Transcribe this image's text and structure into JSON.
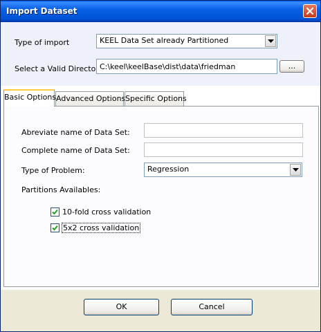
{
  "window": {
    "title": "Import Dataset"
  },
  "import": {
    "type_label": "Type of import",
    "type_value": "KEEL Data Set already Partitioned",
    "dir_label": "Select a Valid Directory",
    "dir_value": "C:\\keel\\keelBase\\dist\\data\\friedman",
    "browse_label": "..."
  },
  "tabs": [
    "Basic Options",
    "Advanced Options",
    "Specific Options"
  ],
  "basic": {
    "abbrev_label": "Abreviate name of Data Set:",
    "abbrev_value": "",
    "complete_label": "Complete name of Data Set:",
    "complete_value": "",
    "problem_label": "Type of Problem:",
    "problem_value": "Regression",
    "partitions_label": "Partitions Availables:",
    "options": [
      {
        "label": "10-fold cross validation",
        "checked": true
      },
      {
        "label": "5x2 cross validation",
        "checked": true
      }
    ]
  },
  "buttons": {
    "ok": "OK",
    "cancel": "Cancel"
  },
  "icons": {
    "close": "close-icon",
    "dropdown": "chevron-down-icon",
    "check": "check-icon"
  }
}
